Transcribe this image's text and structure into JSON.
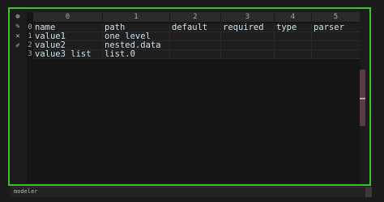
{
  "toolbar": {
    "icons": [
      "target-icon",
      "pin-icon",
      "close-icon",
      "edit-icon"
    ],
    "glyphs": [
      "⊕",
      "✎",
      "✕",
      "✐"
    ]
  },
  "table": {
    "column_indices": [
      "0",
      "1",
      "2",
      "3",
      "4",
      "5"
    ],
    "row_indices": [
      "0",
      "1",
      "2",
      "3"
    ],
    "rows": [
      [
        "name",
        "path",
        "default",
        "required",
        "type",
        "parser"
      ],
      [
        "value1",
        "one_level",
        "",
        "",
        "",
        ""
      ],
      [
        "value2",
        "nested.data",
        "",
        "",
        "",
        ""
      ],
      [
        "value3_list",
        "list.0",
        "",
        "",
        "",
        ""
      ]
    ]
  },
  "status": {
    "label": "modeler"
  },
  "colors": {
    "frame_border": "#39c52a",
    "scroll_thumb": "#5d3a4a",
    "cell_text": "#cfe3ee"
  }
}
